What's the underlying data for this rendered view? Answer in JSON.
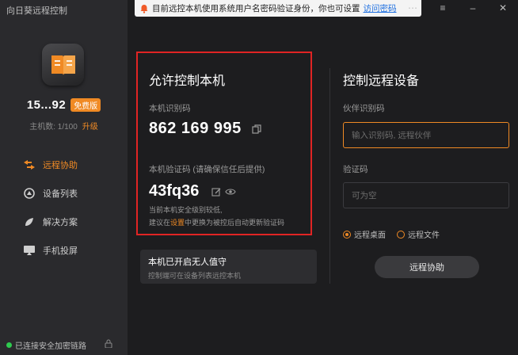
{
  "app": {
    "title": "向日葵远程控制",
    "accent_color": "#f08a24",
    "highlight_color": "#e02424"
  },
  "user": {
    "id": "15...92",
    "edition_badge": "免费版",
    "host_count": "主机数: 1/100",
    "upgrade_label": "升级"
  },
  "sidebar": {
    "items": [
      {
        "label": "远程协助",
        "icon": "remote-assist-icon",
        "active": true
      },
      {
        "label": "设备列表",
        "icon": "device-list-icon",
        "active": false
      },
      {
        "label": "解决方案",
        "icon": "solution-icon",
        "active": false
      },
      {
        "label": "手机投屏",
        "icon": "phone-cast-icon",
        "active": false
      }
    ],
    "status": "已连接安全加密链路"
  },
  "notice": {
    "text": "目前远控本机使用系统用户名密码验证身份，你也可设置",
    "link": "访问密码"
  },
  "window_controls": [
    "more-icon",
    "menu-icon",
    "minimize-icon",
    "close-icon"
  ],
  "allow": {
    "title": "允许控制本机",
    "id_label": "本机识别码",
    "id_value": "862 169 995",
    "code_label": "本机验证码 (请确保信任后提供)",
    "code_value": "43fq36",
    "warning_line1": "当前本机安全级别较低,",
    "warning_line2_pre": "建议在",
    "warning_line2_link": "设置",
    "warning_line2_post": "中更换为被控后自动更新验证码",
    "unattended_title": "本机已开启无人值守",
    "unattended_sub": "控制端可在设备列表远控本机"
  },
  "remote": {
    "title": "控制远程设备",
    "partner_label": "伙伴识别码",
    "partner_placeholder": "输入识别码, 远程伙伴",
    "code_label": "验证码",
    "code_placeholder": "可为空",
    "options": [
      {
        "label": "远程桌面",
        "selected": true
      },
      {
        "label": "远程文件",
        "selected": false
      }
    ],
    "button": "远程协助"
  }
}
